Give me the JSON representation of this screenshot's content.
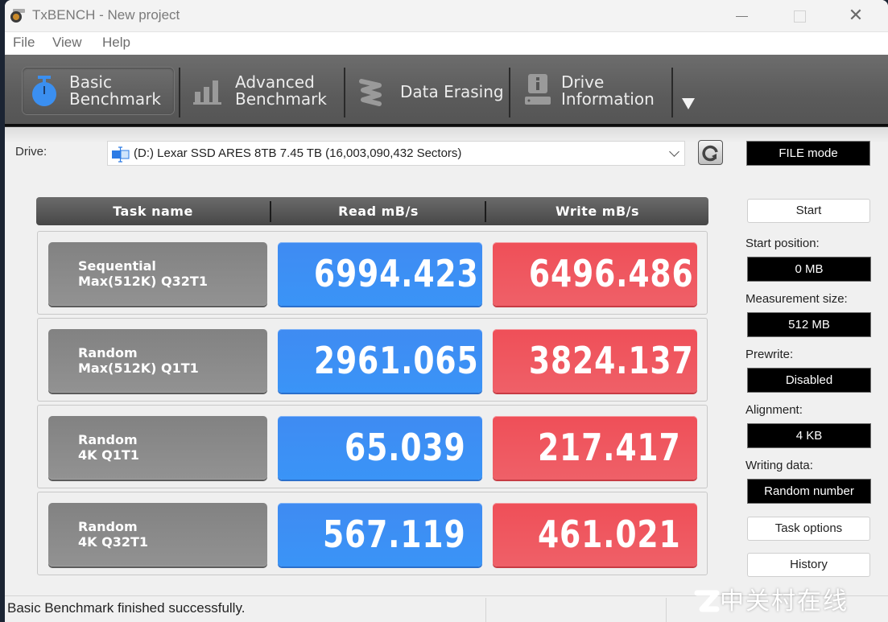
{
  "window": {
    "title": "TxBENCH - New project",
    "close_glyph": "✕"
  },
  "menu": [
    "File",
    "View",
    "Help"
  ],
  "toolbar": {
    "tabs": [
      {
        "label_line1": "Basic",
        "label_line2": "Benchmark",
        "icon": "stopwatch-icon",
        "active": true
      },
      {
        "label_line1": "Advanced",
        "label_line2": "Benchmark",
        "icon": "bar-chart-icon",
        "active": false
      },
      {
        "label_line1": "Data Erasing",
        "label_line2": "",
        "icon": "eraser-icon",
        "active": false
      },
      {
        "label_line1": "Drive",
        "label_line2": "Information",
        "icon": "drive-info-icon",
        "active": false
      }
    ],
    "more_icon": "triangle-down-icon"
  },
  "drive": {
    "label": "Drive:",
    "selected": "(D:) Lexar SSD ARES 8TB  7.45 TB (16,003,090,432 Sectors)"
  },
  "mode": "FILE mode",
  "table": {
    "headers": [
      "Task name",
      "Read mB/s",
      "Write mB/s"
    ],
    "rows": [
      {
        "task": "Sequential\nMax(512K) Q32T1",
        "read": "6994.423",
        "write": "6496.486"
      },
      {
        "task": "Random\nMax(512K) Q1T1",
        "read": "2961.065",
        "write": "3824.137"
      },
      {
        "task": "Random\n4K Q1T1",
        "read": "65.039",
        "write": "217.417"
      },
      {
        "task": "Random\n4K Q32T1",
        "read": "567.119",
        "write": "461.021"
      }
    ]
  },
  "settings": {
    "start_button": "Start",
    "start_position_label": "Start position:",
    "start_position": "0 MB",
    "measurement_size_label": "Measurement size:",
    "measurement_size": "512 MB",
    "prewrite_label": "Prewrite:",
    "prewrite": "Disabled",
    "alignment_label": "Alignment:",
    "alignment": "4 KB",
    "writing_data_label": "Writing data:",
    "writing_data": "Random number",
    "task_options_button": "Task options",
    "history_button": "History"
  },
  "status": "Basic Benchmark finished successfully.",
  "watermark": "中关村在线",
  "colors": {
    "read": "#3d8ef4",
    "write": "#ee5660",
    "active_icon": "#3b8ff0"
  }
}
